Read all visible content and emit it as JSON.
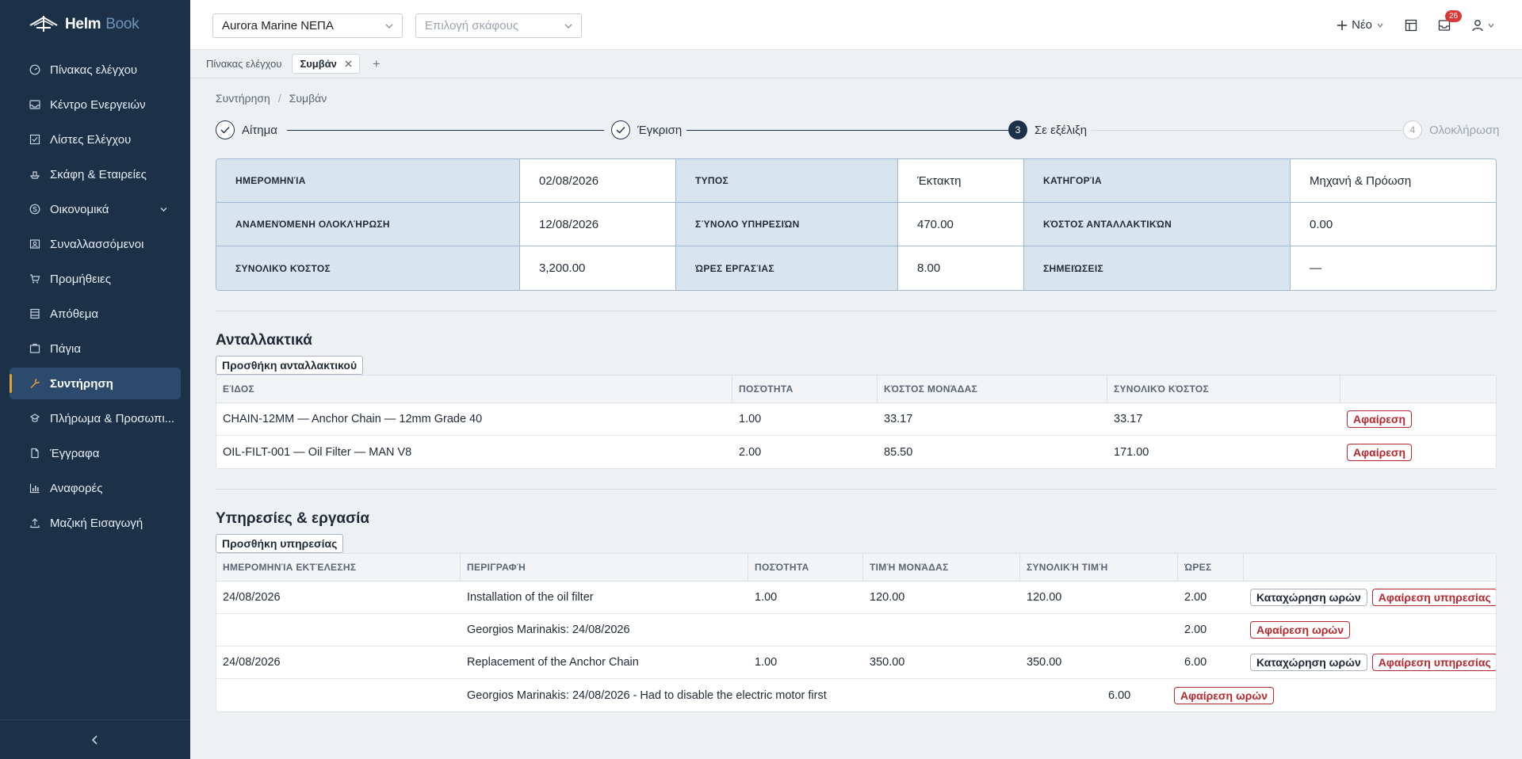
{
  "brand": {
    "name_bold": "Helm",
    "name_light": "Book"
  },
  "sidebar": {
    "items": [
      {
        "label": "Πίνακας ελέγχου",
        "icon": "gauge-icon"
      },
      {
        "label": "Κέντρο Ενεργειών",
        "icon": "inbox-icon"
      },
      {
        "label": "Λίστες Ελέγχου",
        "icon": "checkbox-icon"
      },
      {
        "label": "Σκάφη & Εταιρείες",
        "icon": "ship-icon"
      },
      {
        "label": "Οικονομικά",
        "icon": "finance-icon",
        "expandable": true
      },
      {
        "label": "Συναλλασσόμενοι",
        "icon": "contacts-icon"
      },
      {
        "label": "Προμήθειες",
        "icon": "cart-icon"
      },
      {
        "label": "Απόθεμα",
        "icon": "stock-icon"
      },
      {
        "label": "Πάγια",
        "icon": "assets-icon"
      },
      {
        "label": "Συντήρηση",
        "icon": "wrench-icon",
        "active": true
      },
      {
        "label": "Πλήρωμα & Προσωπι...",
        "icon": "crew-icon"
      },
      {
        "label": "Έγγραφα",
        "icon": "document-icon"
      },
      {
        "label": "Αναφορές",
        "icon": "chart-icon"
      },
      {
        "label": "Μαζική Εισαγωγή",
        "icon": "upload-icon"
      }
    ]
  },
  "topbar": {
    "company": "Aurora Marine ΝΕΠΑ",
    "vessel_placeholder": "Επιλογή σκάφους",
    "new_label": "Νέο",
    "notifications_count": "26"
  },
  "tabs": {
    "home": "Πίνακας ελέγχου",
    "active": "Συμβάν"
  },
  "breadcrumb": {
    "parent": "Συντήρηση",
    "sep": "/",
    "current": "Συμβάν"
  },
  "steps": [
    {
      "label": "Αίτημα",
      "state": "done"
    },
    {
      "label": "Έγκριση",
      "state": "done"
    },
    {
      "label": "Σε εξέλιξη",
      "num": "3",
      "state": "current"
    },
    {
      "label": "Ολοκλήρωση",
      "num": "4",
      "state": "future"
    }
  ],
  "info": [
    {
      "k": "ΗΜΕΡΟΜΗΝΊΑ",
      "v": "02/08/2026"
    },
    {
      "k": "ΤΥΠΟΣ",
      "v": "Έκτακτη"
    },
    {
      "k": "ΚΑΤΗΓΟΡΊΑ",
      "v": "Μηχανή & Πρόωση"
    },
    {
      "k": "ΑΝΑΜΕΝΌΜΕΝΗ ΟΛΟΚΛΉΡΩΣΗ",
      "v": "12/08/2026"
    },
    {
      "k": "ΣΎΝΟΛΟ ΥΠΗΡΕΣΙΏΝ",
      "v": "470.00"
    },
    {
      "k": "ΚΌΣΤΟΣ ΑΝΤΑΛΛΑΚΤΙΚΏΝ",
      "v": "0.00"
    },
    {
      "k": "ΣΥΝΟΛΙΚΌ ΚΌΣΤΟΣ",
      "v": "3,200.00"
    },
    {
      "k": "ΏΡΕΣ ΕΡΓΑΣΊΑΣ",
      "v": "8.00"
    },
    {
      "k": "ΣΗΜΕΙΏΣΕΙΣ",
      "v": "—"
    }
  ],
  "parts": {
    "title": "Ανταλλακτικά",
    "add_label": "Προσθήκη ανταλλακτικού",
    "columns": [
      "ΕΊΔΟΣ",
      "ΠΟΣΌΤΗΤΑ",
      "ΚΌΣΤΟΣ ΜΟΝΆΔΑΣ",
      "ΣΥΝΟΛΙΚΌ ΚΌΣΤΟΣ",
      ""
    ],
    "rows": [
      {
        "item": "CHAIN-12MM — Anchor Chain — 12mm Grade 40",
        "qty": "1.00",
        "unit": "33.17",
        "total": "33.17",
        "remove": "Αφαίρεση"
      },
      {
        "item": "OIL-FILT-001 — Oil Filter — MAN V8",
        "qty": "2.00",
        "unit": "85.50",
        "total": "171.00",
        "remove": "Αφαίρεση"
      }
    ]
  },
  "services": {
    "title": "Υπηρεσίες & εργασία",
    "add_label": "Προσθήκη υπηρεσίας",
    "columns": [
      "ΗΜΕΡΟΜΗΝΊΑ ΕΚΤΈΛΕΣΗΣ",
      "ΠΕΡΙΓΡΑΦΉ",
      "ΠΟΣΌΤΗΤΑ",
      "ΤΙΜΉ ΜΟΝΆΔΑΣ",
      "ΣΥΝΟΛΙΚΉ ΤΙΜΉ",
      "ΏΡΕΣ",
      ""
    ],
    "rows": [
      {
        "date": "24/08/2026",
        "desc": "Installation of the oil filter",
        "qty": "1.00",
        "unit": "120.00",
        "total": "120.00",
        "hours": "2.00",
        "log_label": "Καταχώρηση ωρών",
        "remove_label": "Αφαίρεση υπηρεσίας"
      },
      {
        "date": "",
        "desc": "Georgios Marinakis: 24/08/2026",
        "qty": "",
        "unit": "",
        "total": "",
        "hours": "2.00",
        "remove_hours_label": "Αφαίρεση ωρών"
      },
      {
        "date": "24/08/2026",
        "desc": "Replacement of the Anchor Chain",
        "qty": "1.00",
        "unit": "350.00",
        "total": "350.00",
        "hours": "6.00",
        "log_label": "Καταχώρηση ωρών",
        "remove_label": "Αφαίρεση υπηρεσίας"
      },
      {
        "date": "",
        "desc": "Georgios Marinakis: 24/08/2026 - Had to disable the electric motor first",
        "qty": "",
        "unit": "",
        "total": "",
        "hours": "6.00",
        "remove_hours_label": "Αφαίρεση ωρών"
      }
    ]
  }
}
